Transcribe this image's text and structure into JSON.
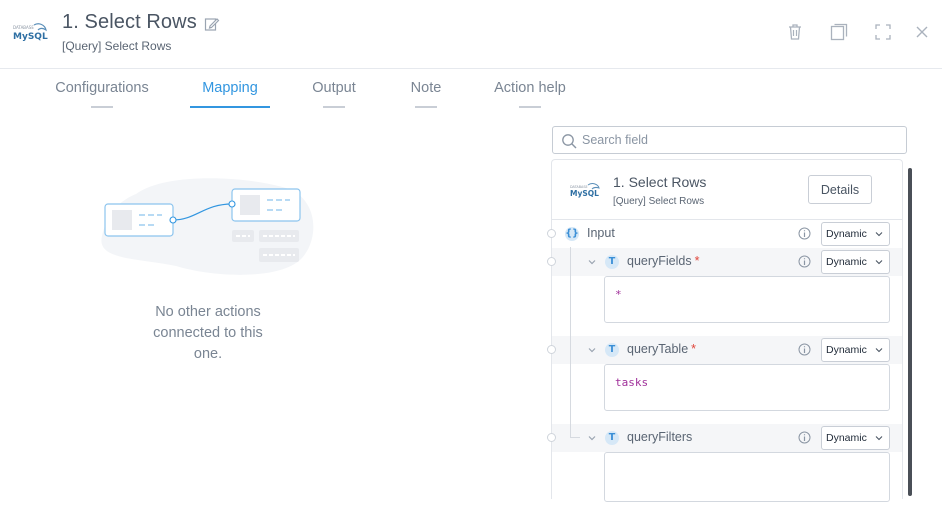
{
  "header": {
    "logo_text": "MySQL",
    "title": "1. Select Rows",
    "subtitle": "[Query] Select Rows",
    "buttons": [
      "delete-icon",
      "clone-icon",
      "expand-icon",
      "close-icon"
    ]
  },
  "tabs": [
    {
      "label": "Configurations",
      "active": false
    },
    {
      "label": "Mapping",
      "active": true
    },
    {
      "label": "Output",
      "active": false
    },
    {
      "label": "Note",
      "active": false
    },
    {
      "label": "Action help",
      "active": false
    }
  ],
  "mapping_empty": {
    "message": "No other actions connected to this one."
  },
  "search": {
    "placeholder": "Search field",
    "value": ""
  },
  "panel": {
    "logo_text": "MySQL",
    "title": "1. Select Rows",
    "subtitle": "[Query] Select Rows",
    "details_label": "Details",
    "input": {
      "label": "Input",
      "type_badge": "{}",
      "mode": "Dynamic"
    },
    "fields": [
      {
        "name": "queryFields",
        "type_badge": "T",
        "required": true,
        "mode": "Dynamic",
        "value": "*"
      },
      {
        "name": "queryTable",
        "type_badge": "T",
        "required": true,
        "mode": "Dynamic",
        "value": "tasks"
      },
      {
        "name": "queryFilters",
        "type_badge": "T",
        "required": false,
        "mode": "Dynamic",
        "value": ""
      }
    ]
  },
  "colors": {
    "accent": "#3296e0",
    "required": "#e0453a",
    "value_text": "#a0309a"
  }
}
